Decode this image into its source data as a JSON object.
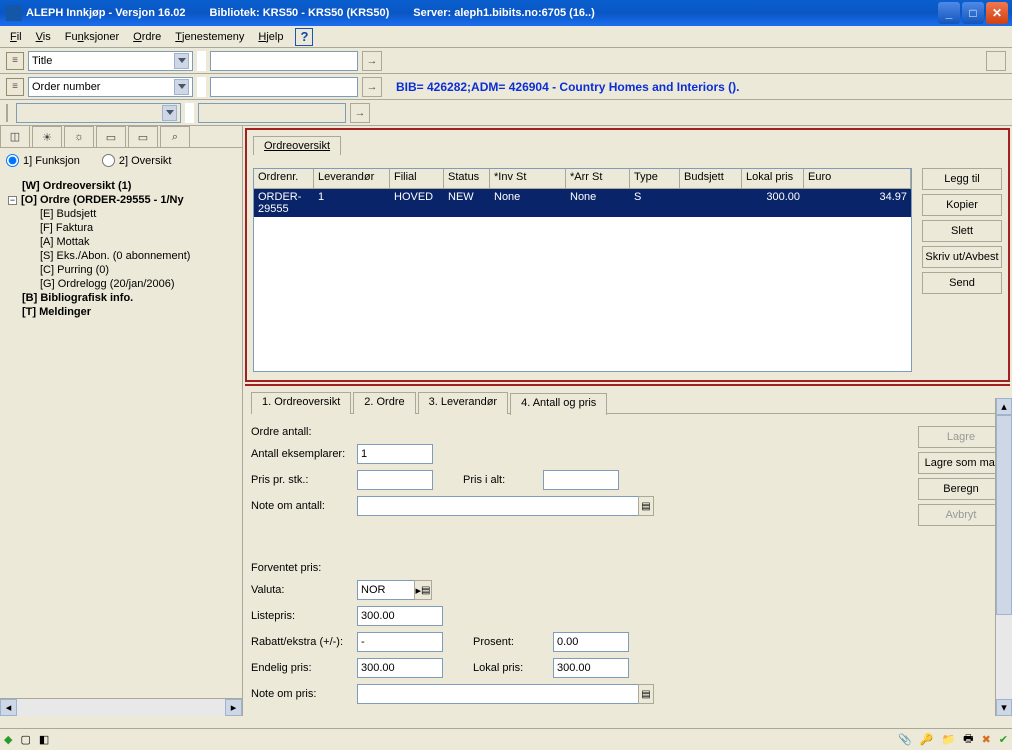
{
  "titlebar": {
    "app": "ALEPH Innkjøp - Versjon 16.02",
    "bibliotek": "Bibliotek:  KRS50 - KRS50 (KRS50)",
    "server": "Server:  aleph1.bibits.no:6705 (16..)"
  },
  "menu": {
    "fil": "Fil",
    "vis": "Vis",
    "funksjoner": "Funksjoner",
    "ordre": "Ordre",
    "tjenestemeny": "Tjenestemeny",
    "hjelp": "Hjelp"
  },
  "search1": {
    "label": "Title"
  },
  "search2": {
    "label": "Order number",
    "info": "BIB= 426282;ADM= 426904 - Country Homes and Interiors ()."
  },
  "radios": {
    "r1": "1] Funksjon",
    "r2": "2] Oversikt"
  },
  "tree": {
    "w": "[W] Ordreoversikt (1)",
    "o": "[O] Ordre (ORDER-29555 - 1/Ny",
    "e": "[E] Budsjett",
    "f": "[F] Faktura",
    "a": "[A] Mottak",
    "s": "[S] Eks./Abon. (0 abonnement)",
    "c": "[C] Purring (0)",
    "g": "[G] Ordrelogg (20/jan/2006)",
    "b": "[B] Bibliografisk info.",
    "t": "[T] Meldinger"
  },
  "toptab": "Ordreoversikt",
  "grid": {
    "headers": [
      "Ordrenr.",
      "Leverandør",
      "Filial",
      "Status",
      "*Inv St",
      "*Arr St",
      "Type",
      "Budsjett",
      "Lokal pris",
      "Euro"
    ],
    "row": [
      "ORDER-29555",
      "1",
      "HOVED",
      "NEW",
      "None",
      "None",
      "S",
      "",
      "300.00",
      "34.97"
    ]
  },
  "topbtns": {
    "leggtil": "Legg til",
    "kopier": "Kopier",
    "slett": "Slett",
    "skriv": "Skriv ut/Avbest",
    "send": "Send"
  },
  "bottomtabs": {
    "t1": "1. Ordreoversikt",
    "t2": "2. Ordre",
    "t3": "3. Leverandør",
    "t4": "4. Antall og pris"
  },
  "form": {
    "ordre_antall": "Ordre antall:",
    "antall_eks": "Antall eksemplarer:",
    "antall_eks_v": "1",
    "pris_stk": "Pris pr. stk.:",
    "pris_alt": "Pris i alt:",
    "note_antall": "Note om antall:",
    "forventet": "Forventet pris:",
    "valuta": "Valuta:",
    "valuta_v": "NOR",
    "listepris": "Listepris:",
    "listepris_v": "300.00",
    "rabatt": "Rabatt/ekstra (+/-):",
    "rabatt_v": "-",
    "prosent": "Prosent:",
    "prosent_v": "0.00",
    "endelig": "Endelig pris:",
    "endelig_v": "300.00",
    "lokal": "Lokal pris:",
    "lokal_v": "300.00",
    "note_pris": "Note om pris:"
  },
  "formbtns": {
    "lagre": "Lagre",
    "mal": "Lagre som mal",
    "beregn": "Beregn",
    "avbryt": "Avbryt"
  }
}
